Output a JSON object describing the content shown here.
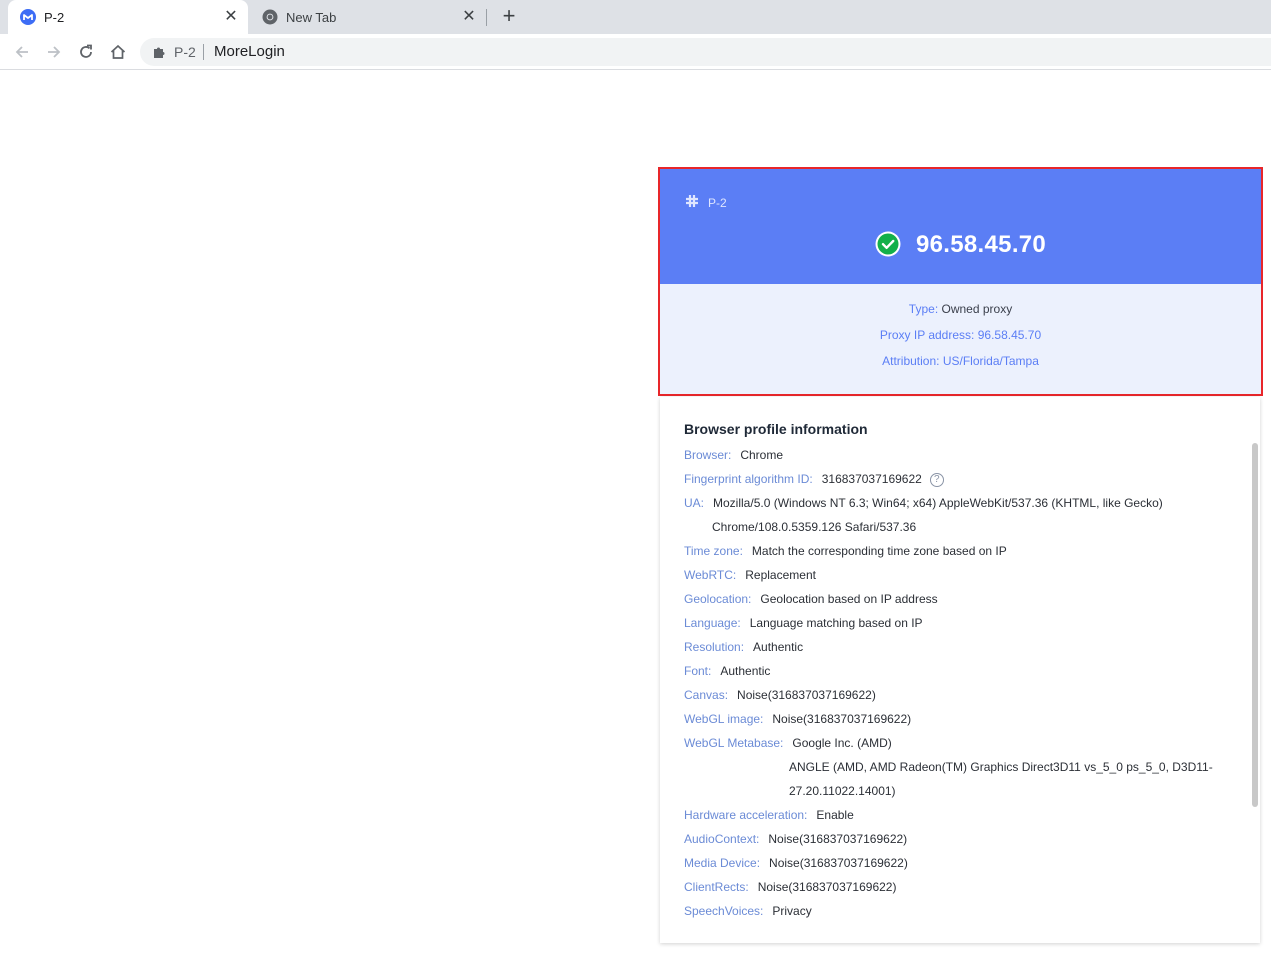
{
  "tabs": [
    {
      "title": "P-2",
      "icon": "morelogin-icon",
      "active": true
    },
    {
      "title": "New Tab",
      "icon": "chrome-icon",
      "active": false
    }
  ],
  "toolbar": {
    "omnibox_name": "P-2",
    "omnibox_title": "MoreLogin"
  },
  "proxy": {
    "profile_name": "P-2",
    "ip": "96.58.45.70",
    "type_label": "Type:",
    "type_value": "Owned proxy",
    "address_label": "Proxy IP address:",
    "address_value": "96.58.45.70",
    "attribution_label": "Attribution:",
    "attribution_value": "US/Florida/Tampa"
  },
  "profile_info": {
    "title": "Browser profile information",
    "rows": [
      {
        "label": "Browser:",
        "value": "Chrome"
      },
      {
        "label": "Fingerprint algorithm ID:",
        "value": "316837037169622"
      },
      {
        "label": "UA:",
        "value": "Mozilla/5.0 (Windows NT 6.3; Win64; x64) AppleWebKit/537.36 (KHTML, like Gecko)",
        "value2": "Chrome/108.0.5359.126 Safari/537.36"
      },
      {
        "label": "Time zone:",
        "value": "Match the corresponding time zone based on IP"
      },
      {
        "label": "WebRTC:",
        "value": "Replacement"
      },
      {
        "label": "Geolocation:",
        "value": "Geolocation based on IP address"
      },
      {
        "label": "Language:",
        "value": "Language matching based on IP"
      },
      {
        "label": "Resolution:",
        "value": "Authentic"
      },
      {
        "label": "Font:",
        "value": "Authentic"
      },
      {
        "label": "Canvas:",
        "value": "Noise(316837037169622)"
      },
      {
        "label": "WebGL image:",
        "value": "Noise(316837037169622)"
      },
      {
        "label": "WebGL Metabase:",
        "value": "Google Inc. (AMD)",
        "value2": "ANGLE (AMD, AMD Radeon(TM) Graphics Direct3D11 vs_5_0 ps_5_0, D3D11-",
        "value3": "27.20.11022.14001)"
      },
      {
        "label": "Hardware acceleration:",
        "value": "Enable"
      },
      {
        "label": "AudioContext:",
        "value": "Noise(316837037169622)"
      },
      {
        "label": "Media Device:",
        "value": "Noise(316837037169622)"
      },
      {
        "label": "ClientRects:",
        "value": "Noise(316837037169622)"
      },
      {
        "label": "SpeechVoices:",
        "value": "Privacy"
      }
    ]
  },
  "colors": {
    "header_blue": "#5b7ef5",
    "panel_bg": "#ecf1fd",
    "highlight_border": "#e8262a",
    "success_green": "#13b04a"
  }
}
